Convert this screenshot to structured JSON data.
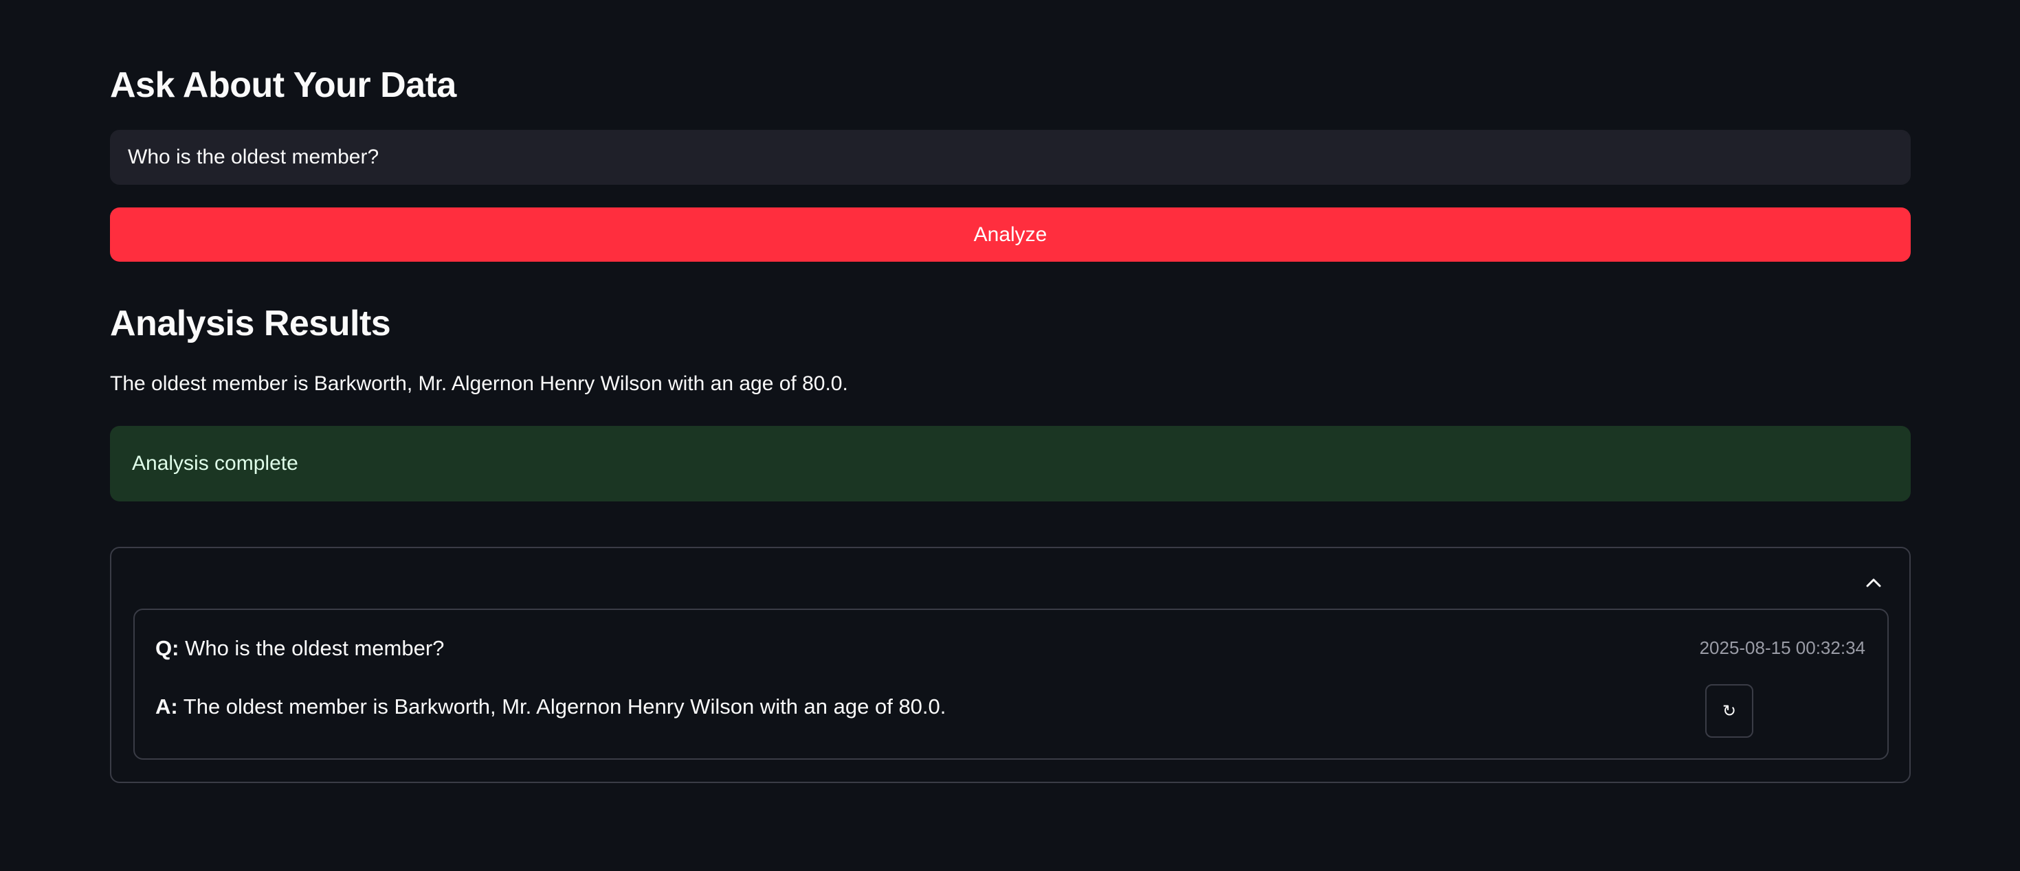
{
  "ask": {
    "title": "Ask About Your Data",
    "query_value": "Who is the oldest member?",
    "analyze_label": "Analyze"
  },
  "results": {
    "title": "Analysis Results",
    "answer": "The oldest member is Barkworth, Mr. Algernon Henry Wilson with an age of 80.0.",
    "status": "Analysis complete"
  },
  "history": {
    "expanded": true,
    "toggle_icon": "chevron-up-icon",
    "items": [
      {
        "q_label": "Q:",
        "question": "Who is the oldest member?",
        "a_label": "A:",
        "answer": "The oldest member is Barkworth, Mr. Algernon Henry Wilson with an age of 80.0.",
        "timestamp": "2025-08-15 00:32:34",
        "rerun_icon": "↻"
      }
    ]
  },
  "colors": {
    "background": "#0e1117",
    "primary": "#ff2e3e",
    "input_bg": "#1f2029",
    "success_bg": "#1b3623",
    "success_text": "#dffde9",
    "border": "#3a3c46"
  }
}
